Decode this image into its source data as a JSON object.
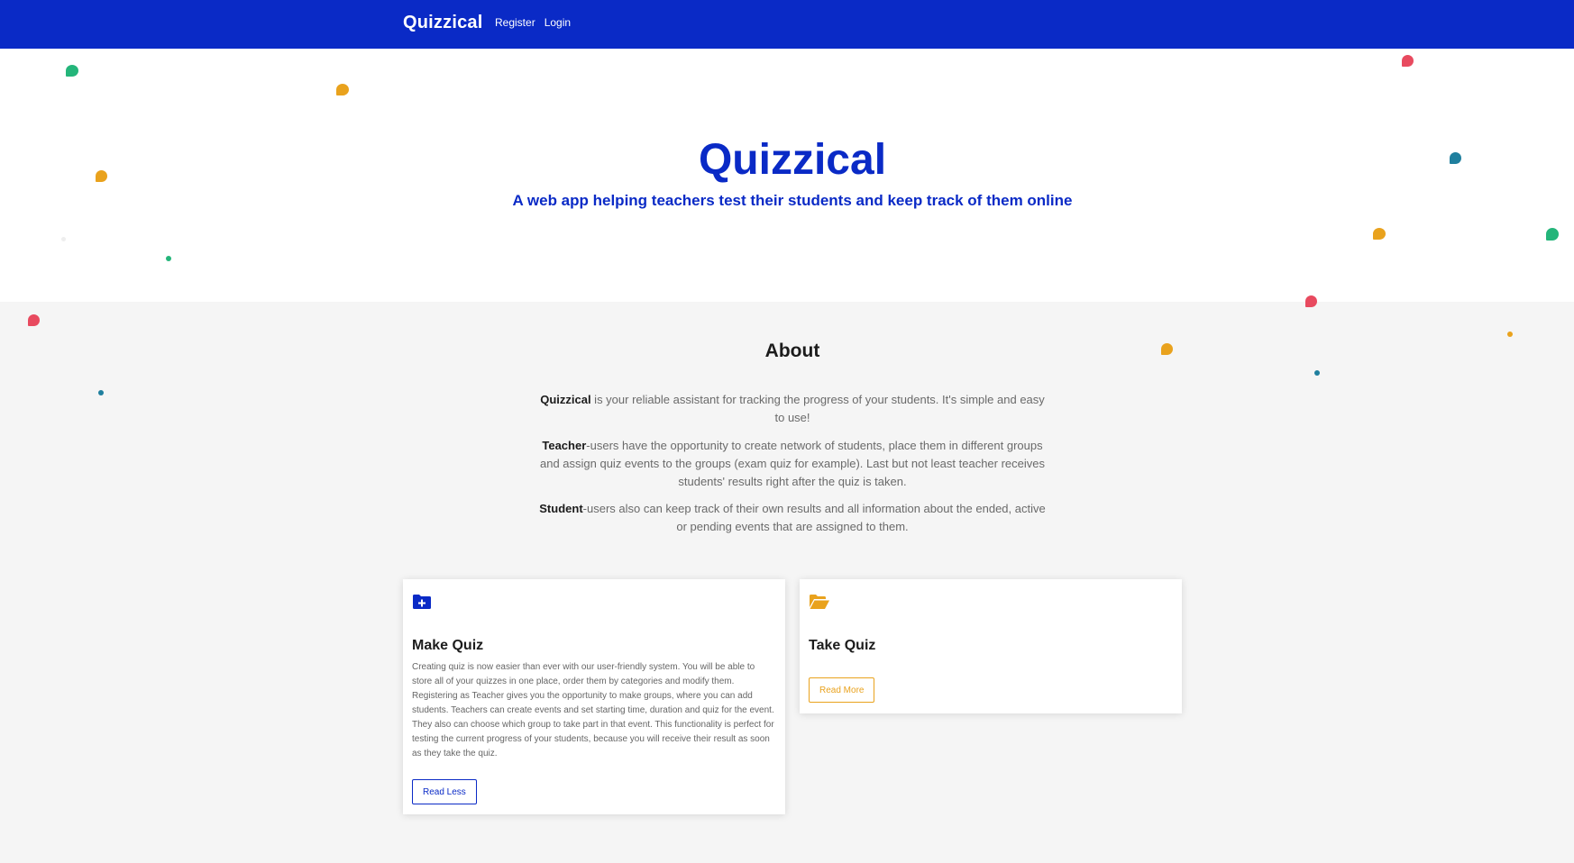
{
  "navbar": {
    "brand": "Quizzical",
    "links": [
      "Register",
      "Login"
    ]
  },
  "hero": {
    "title": "Quizzical",
    "subtitle": "A web app helping teachers test their students and keep track of them online"
  },
  "about": {
    "title": "About",
    "paragraphs": [
      {
        "bold": "Quizzical",
        "text": " is your reliable assistant for tracking the progress of your students. It's simple and easy to use!"
      },
      {
        "bold": "Teacher",
        "text": "-users have the opportunity to create network of students, place them in different groups and assign quiz events to the groups (exam quiz for example). Last but not least teacher receives students' results right after the quiz is taken."
      },
      {
        "bold": "Student",
        "text": "-users also can keep track of their own results and all information about the ended, active or pending events that are assigned to them."
      }
    ]
  },
  "cards": [
    {
      "icon": "folder-plus-icon",
      "title": "Make Quiz",
      "text": "Creating quiz is now easier than ever with our user-friendly system. You will be able to store all of your quizzes in one place, order them by categories and modify them. Registering as Teacher gives you the opportunity to make groups, where you can add students. Teachers can create events and set starting time, duration and quiz for the event. They also can choose which group to take part in that event. This functionality is perfect for testing the current progress of your students, because you will receive their result as soon as they take the quiz.",
      "button": "Read Less"
    },
    {
      "icon": "folder-open-icon",
      "title": "Take Quiz",
      "button": "Read More"
    }
  ],
  "colors": {
    "primary": "#0a2ac6",
    "accent": "#e9a21d",
    "background": "#f5f5f5",
    "confetti": [
      "#24b57a",
      "#e9a21d",
      "#e84a5f",
      "#1f7f9e"
    ]
  }
}
